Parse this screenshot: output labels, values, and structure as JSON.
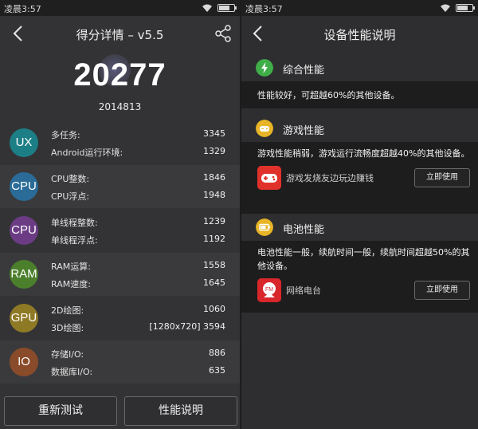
{
  "status": {
    "time_left": "凌晨3:57",
    "time_right": "凌晨3:57"
  },
  "left": {
    "title": "得分详情 – v5.5",
    "score": "20277",
    "device": "2014813",
    "categories": [
      {
        "abbr": "UX",
        "color": "#1d7f86",
        "rows": [
          {
            "label": "多任务:",
            "value": "3345"
          },
          {
            "label": "Android运行环境:",
            "value": "1329"
          }
        ]
      },
      {
        "abbr": "CPU",
        "color": "#2a6b98",
        "rows": [
          {
            "label": "CPU整数:",
            "value": "1846"
          },
          {
            "label": "CPU浮点:",
            "value": "1948"
          }
        ]
      },
      {
        "abbr": "CPU",
        "color": "#6b3c84",
        "rows": [
          {
            "label": "单线程整数:",
            "value": "1239"
          },
          {
            "label": "单线程浮点:",
            "value": "1192"
          }
        ]
      },
      {
        "abbr": "RAM",
        "color": "#4c7f2c",
        "rows": [
          {
            "label": "RAM运算:",
            "value": "1558"
          },
          {
            "label": "RAM速度:",
            "value": "1645"
          }
        ]
      },
      {
        "abbr": "GPU",
        "color": "#8e7a25",
        "rows": [
          {
            "label": "2D绘图:",
            "value": "1060"
          },
          {
            "label": "3D绘图:",
            "value": "[1280x720] 3594"
          }
        ]
      },
      {
        "abbr": "IO",
        "color": "#8a4b2a",
        "rows": [
          {
            "label": "存储I/O:",
            "value": "886"
          },
          {
            "label": "数据库I/O:",
            "value": "635"
          }
        ]
      }
    ],
    "buttons": {
      "retest": "重新测试",
      "explain": "性能说明"
    }
  },
  "right": {
    "title": "设备性能说明",
    "sections": [
      {
        "icon": "lightning-icon",
        "color": "#3fae49",
        "title": "综合性能",
        "text": "性能较好，可超越60%的其他设备。"
      },
      {
        "icon": "gamepad-icon",
        "color": "#e7b527",
        "title": "游戏性能",
        "text": "游戏性能稍弱，游戏运行流畅度超越40%的其他设备。",
        "app": "游戏发烧友边玩边赚钱",
        "button": "立即使用"
      },
      {
        "icon": "battery-icon",
        "color": "#e7b527",
        "title": "电池性能",
        "text": "电池性能一般，续航时间一般，续航时间超越50%的其他设备。",
        "app": "网络电台",
        "button": "立即使用"
      }
    ]
  }
}
